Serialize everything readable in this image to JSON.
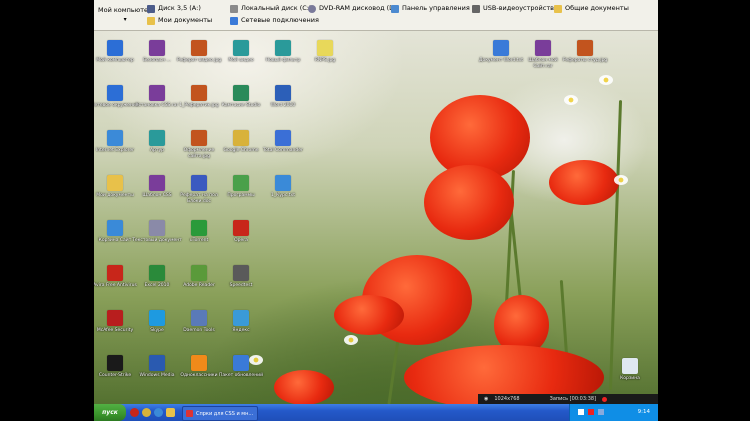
{
  "toolbar": {
    "my_computer": "Мой компьютер",
    "row1": [
      {
        "label": "Диск 3,5 (A:)",
        "icon": "floppy-icon",
        "color": "#4c5c8a"
      },
      {
        "label": "Локальный диск (C:)",
        "icon": "disk-icon",
        "color": "#8a8a8a"
      },
      {
        "label": "DVD-RAM дисковод (D:)",
        "icon": "dvd-icon",
        "color": "#7a7a9a"
      },
      {
        "label": "Панель управления",
        "icon": "control-panel-icon",
        "color": "#4c8ad0"
      },
      {
        "label": "USB-видеоустройство",
        "icon": "usb-camera-icon",
        "color": "#666666"
      },
      {
        "label": "Общие документы",
        "icon": "folder-icon",
        "color": "#e8c14a"
      }
    ],
    "row2": [
      {
        "label": "Мои документы",
        "icon": "folder-icon",
        "color": "#e8c14a"
      },
      {
        "label": "Сетевые подключения",
        "icon": "network-icon",
        "color": "#3a7ad8"
      }
    ]
  },
  "desktop": {
    "icons_left": [
      {
        "label": "Мой компьютер",
        "color": "#2c6ed6"
      },
      {
        "label": "Безопасн ...",
        "color": "#7a3d9a"
      },
      {
        "label": "Реферат видео.jpg",
        "color": "#c2541e"
      },
      {
        "label": "Мой видео",
        "color": "#2a9a9a"
      },
      {
        "label": "Новый фильтр",
        "color": "#2a9a9a"
      },
      {
        "label": "RNPS.jpg",
        "color": "#e8d85a"
      },
      {
        "label": "Сетевое окружение",
        "color": "#2c6ed6"
      },
      {
        "label": "Установка CSS.rar",
        "color": "#7a3d9a"
      },
      {
        "label": "1_Рефератик.jpg",
        "color": "#c2541e"
      },
      {
        "label": "Камтасия Studio",
        "color": "#2a8a5a"
      },
      {
        "label": "Word 2010",
        "color": "#2c5fb8"
      },
      {
        "label": "Internet Explorer",
        "color": "#3b8ad8"
      },
      {
        "label": "Артур",
        "color": "#2a9a9a"
      },
      {
        "label": "Оформление сайта.jpg",
        "color": "#c2541e"
      },
      {
        "label": "Google Chrome",
        "color": "#d8b23a"
      },
      {
        "label": "Total Commander",
        "color": "#3b6fd6"
      },
      {
        "label": "Мои документы",
        "color": "#e8c14a"
      },
      {
        "label": "Шаблон CSS",
        "color": "#7a3d9a"
      },
      {
        "label": "Реферат на пол Блоки.doc",
        "color": "#3a5ac0"
      },
      {
        "label": "Программы",
        "color": "#4aa04a"
      },
      {
        "label": "1_Курс.txt",
        "color": "#3a8ad8"
      },
      {
        "label": "Корзина Сайт",
        "color": "#3a8ad8"
      },
      {
        "label": "Текстовый документ",
        "color": "#8a8aa8"
      },
      {
        "label": "uTorrent",
        "color": "#2a9a3a"
      },
      {
        "label": "Opera",
        "color": "#c8261a"
      },
      {
        "label": "Avira Free Antivirus",
        "color": "#c8261a"
      },
      {
        "label": "Excel 2010",
        "color": "#2a8a3a"
      },
      {
        "label": "Adobe Reader",
        "color": "#5a9a3a"
      },
      {
        "label": "Speedtest",
        "color": "#5a5a5a"
      },
      {
        "label": "McAfee Security",
        "color": "#b81e1e"
      },
      {
        "label": "Skype",
        "color": "#1e9ae0"
      },
      {
        "label": "Daemon Tools",
        "color": "#5a7ab8"
      },
      {
        "label": "Яндекс",
        "color": "#3a9ad8"
      },
      {
        "label": "Counter-Strike",
        "color": "#1a1a1a"
      },
      {
        "label": "Windows Media",
        "color": "#2a5ab0"
      },
      {
        "label": "Одноклассники",
        "color": "#f08a1a"
      },
      {
        "label": "Пакет обновлений",
        "color": "#3a7ad8"
      }
    ],
    "icons_right": [
      {
        "label": "Документ Word.txt",
        "color": "#3a7ad8"
      },
      {
        "label": "Шаблон мой Сайт.rar",
        "color": "#7a3d9a"
      },
      {
        "label": "Рефераты студ.jpg",
        "color": "#c2541e"
      }
    ],
    "recycle_bin": {
      "label": "Корзина",
      "color": "#dfe8f0"
    }
  },
  "recorder": {
    "resolution": "1024x768",
    "status": "Запись [00:03:38]"
  },
  "taskbar": {
    "start": "пуск",
    "task_label": "Спрки для CSS и мн...",
    "lang": "RL",
    "clock": "9:14"
  }
}
